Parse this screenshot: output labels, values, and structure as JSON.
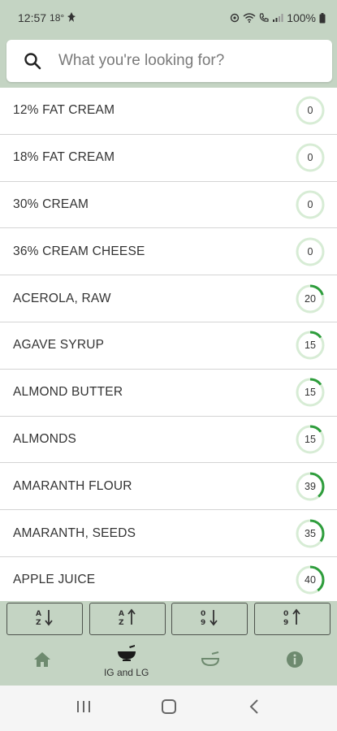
{
  "status_bar": {
    "time": "12:57",
    "temperature": "18°",
    "battery": "100%"
  },
  "search": {
    "placeholder": "What you're looking for?"
  },
  "items": [
    {
      "name": "12% FAT CREAM",
      "gi": 0
    },
    {
      "name": "18% FAT CREAM",
      "gi": 0
    },
    {
      "name": "30% CREAM",
      "gi": 0
    },
    {
      "name": "36% CREAM CHEESE",
      "gi": 0
    },
    {
      "name": "ACEROLA, RAW",
      "gi": 20
    },
    {
      "name": "AGAVE SYRUP",
      "gi": 15
    },
    {
      "name": "ALMOND BUTTER",
      "gi": 15
    },
    {
      "name": "ALMONDS",
      "gi": 15
    },
    {
      "name": "AMARANTH FLOUR",
      "gi": 39
    },
    {
      "name": "AMARANTH, SEEDS",
      "gi": 35
    },
    {
      "name": "APPLE JUICE",
      "gi": 40
    }
  ],
  "sort_buttons": [
    {
      "icon": "sort-alpha-ascending-icon"
    },
    {
      "icon": "sort-alpha-descending-icon"
    },
    {
      "icon": "sort-numeric-ascending-icon"
    },
    {
      "icon": "sort-numeric-descending-icon"
    }
  ],
  "bottom_nav": [
    {
      "icon": "home-icon",
      "label": ""
    },
    {
      "icon": "bowl-icon",
      "label": "IG and LG",
      "active": true
    },
    {
      "icon": "dish-icon",
      "label": ""
    },
    {
      "icon": "info-icon",
      "label": ""
    }
  ],
  "colors": {
    "bar_bg": "#c4d4c3",
    "ring_track": "#d7ecd5",
    "ring_progress": "#2e9d3c"
  }
}
